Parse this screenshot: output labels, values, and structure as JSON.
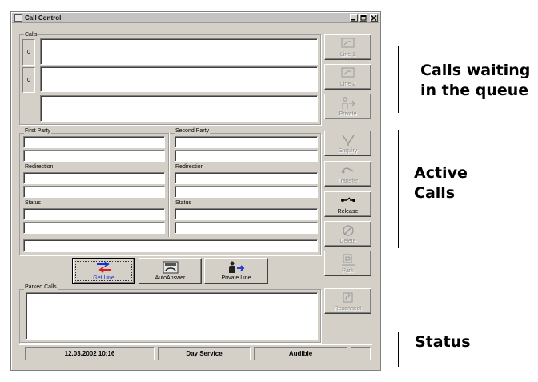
{
  "window": {
    "title": "Call Control"
  },
  "calls_group": {
    "label": "Calls",
    "counters": [
      "0",
      "0"
    ]
  },
  "party": {
    "first_label": "First Party",
    "second_label": "Second Party",
    "redirection_label": "Redirection",
    "status_label": "Status"
  },
  "side_buttons": {
    "line1": "Line 1",
    "line2": "Line 2",
    "private": "Private",
    "enquiry": "Enquiry",
    "transfer": "Transfer",
    "release": "Release",
    "delete": "Delete",
    "park": "Park",
    "reconnect": "Reconnect"
  },
  "action_buttons": {
    "get_line": "Get Line",
    "auto_answer": "AutoAnswer",
    "private_line": "Private Line"
  },
  "parked": {
    "label": "Parked Calls"
  },
  "statusbar": {
    "datetime": "12.03.2002 10:16",
    "service": "Day Service",
    "audio": "Audible"
  },
  "annotations": {
    "queue": "Calls waiting\nin the queue",
    "active": "Active\nCalls",
    "status": "Status"
  },
  "colors": {
    "window_bg": "#d4d0c8",
    "get_line_blue": "#1a2fd0",
    "disabled_text": "#8a8a8a"
  }
}
